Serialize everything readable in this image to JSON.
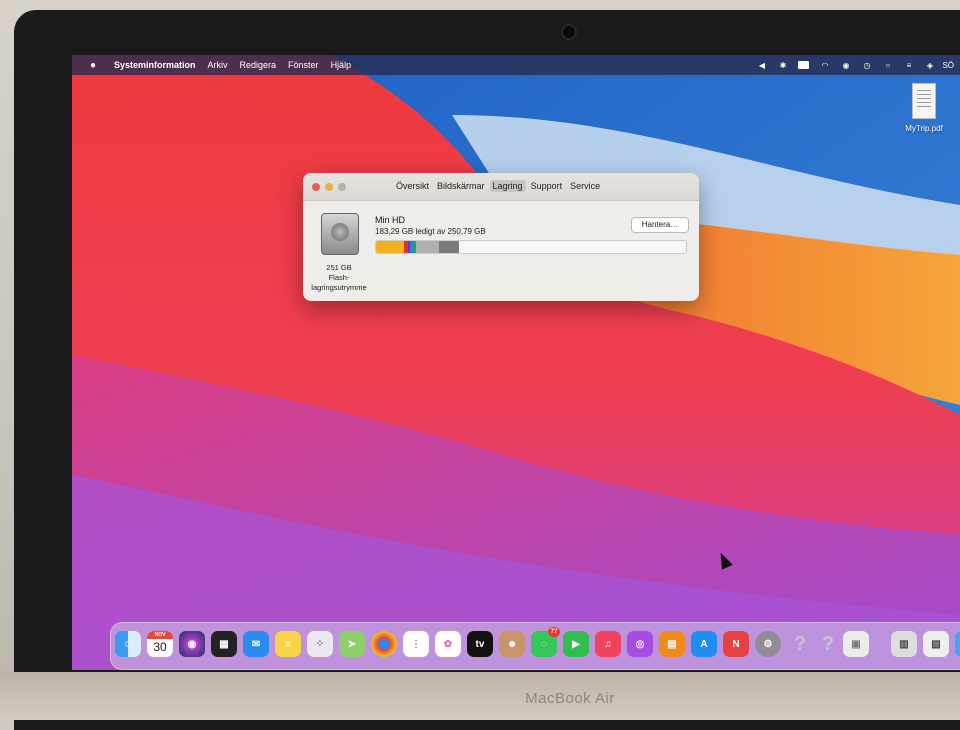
{
  "device": {
    "label": "MacBook Air"
  },
  "menubar": {
    "apple_icon": "apple-logo",
    "app_name": "Systeminformation",
    "items": [
      "Arkiv",
      "Redigera",
      "Fönster",
      "Hjälp"
    ],
    "clock_fragment": "SÖ",
    "status_icons": [
      "volume-icon",
      "bluetooth-icon",
      "battery-icon",
      "wifi-icon",
      "user-icon",
      "time-machine-icon",
      "search-icon",
      "control-center-icon",
      "siri-icon"
    ]
  },
  "desktop": {
    "file_name": "MyTrip.pdf"
  },
  "window": {
    "tabs": [
      "Översikt",
      "Bildskärmar",
      "Lagring",
      "Support",
      "Service"
    ],
    "active_tab": "Lagring",
    "volume_name": "Min HD",
    "free_text": "183,29 GB ledigt av 250,79 GB",
    "manage_label": "Hantera…",
    "disk_caption": [
      "251 GB",
      "Flash-",
      "lagringsutrymme"
    ],
    "usage_fraction": 0.269,
    "segment_colors": [
      "#f2b01e",
      "#e2331e",
      "#6b36b8",
      "#2d7fe0",
      "#26a541",
      "#b0b0b0",
      "#7a7a7a"
    ]
  },
  "dock": {
    "calendar": {
      "month": "NOV",
      "day": "30"
    },
    "messages_badge": "77",
    "apps": [
      "finder",
      "calendar",
      "siri",
      "launchpad-widgets",
      "mail",
      "notes",
      "launchpad",
      "maps",
      "chrome",
      "reminders",
      "photos",
      "apple-tv",
      "contacts",
      "messages",
      "facetime",
      "music",
      "podcasts",
      "books",
      "app-store",
      "news",
      "system-preferences",
      "unknown-app",
      "unknown-app",
      "preview"
    ],
    "right_items": [
      "downloads-stack",
      "trash-stack",
      "finder-window"
    ]
  }
}
